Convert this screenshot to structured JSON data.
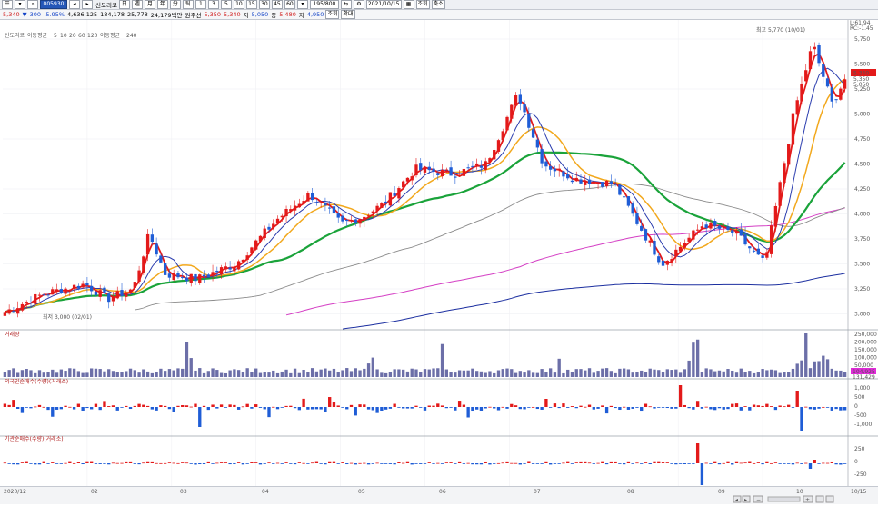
{
  "toolbar": {
    "code": "005930",
    "stock_name": "신도리코",
    "price": "5,340",
    "change": "300",
    "change_pct": "-5.95%",
    "volume": "4,636,125",
    "turnover": "184,178",
    "ratio": "25,778",
    "amount": "24,179백만",
    "market": "원주선",
    "open_label": "시",
    "open": "5,350",
    "high": "5,340",
    "high_label": "고",
    "low_label": "저",
    "low": "5,050",
    "close_label": "종",
    "close": "5,480",
    "prev": "4,950",
    "minute_buttons": [
      "1",
      "3",
      "5",
      "10",
      "15",
      "30",
      "45",
      "60"
    ],
    "count": "195/800",
    "date": "2021/10/15",
    "btn_query": "조회",
    "btn_zoom": "축소",
    "btn_next": "확대"
  },
  "legend": {
    "stock": "신도리코",
    "ma_label": "이동평균",
    "ma_periods": [
      "5",
      "10",
      "20",
      "60",
      "120"
    ],
    "ma240_label": "이동평균",
    "ma240": "240"
  },
  "price_axis": {
    "ticks": [
      "5,750",
      "5,500",
      "5,250",
      "5,000",
      "4,750",
      "4,500",
      "4,250",
      "4,000",
      "3,750",
      "3,500",
      "3,250",
      "3,000"
    ],
    "top_info": [
      "L:61.94",
      "RC:-1.45"
    ],
    "current": "5,340",
    "high_tag": "5,350",
    "low_tag": "5,050"
  },
  "annotations": {
    "high": "최고 5,770 (10/01)",
    "low": "최저 3,000 (02/01)"
  },
  "panels": {
    "volume_title": "거래량",
    "volume_ticks": [
      "250,000",
      "200,000",
      "150,000",
      "100,000",
      "50,000"
    ],
    "volume_current": "104,925",
    "volume_current2": "131,429",
    "foreign_title": "외국인순매수(수량)(거래소)",
    "foreign_ticks": [
      "1,000",
      "500",
      "0",
      "-500",
      "-1,000"
    ],
    "inst_title": "기관순매수(수량)(거래소)",
    "inst_ticks": [
      "250",
      "0",
      "-250"
    ]
  },
  "x_axis": {
    "labels": [
      "2020/12",
      "02",
      "03",
      "04",
      "05",
      "06",
      "07",
      "08",
      "09",
      "10",
      "10/15"
    ]
  },
  "colors": {
    "up": "#e31a1a",
    "down": "#1f5dd6",
    "ma5": "#e31a1a",
    "ma10": "#2a3cae",
    "ma20": "#f2a81d",
    "ma60": "#1aa33a",
    "ma120": "#8a8a8a",
    "ma240": "#d43fc4",
    "ma480": "#1c2fa0"
  }
}
